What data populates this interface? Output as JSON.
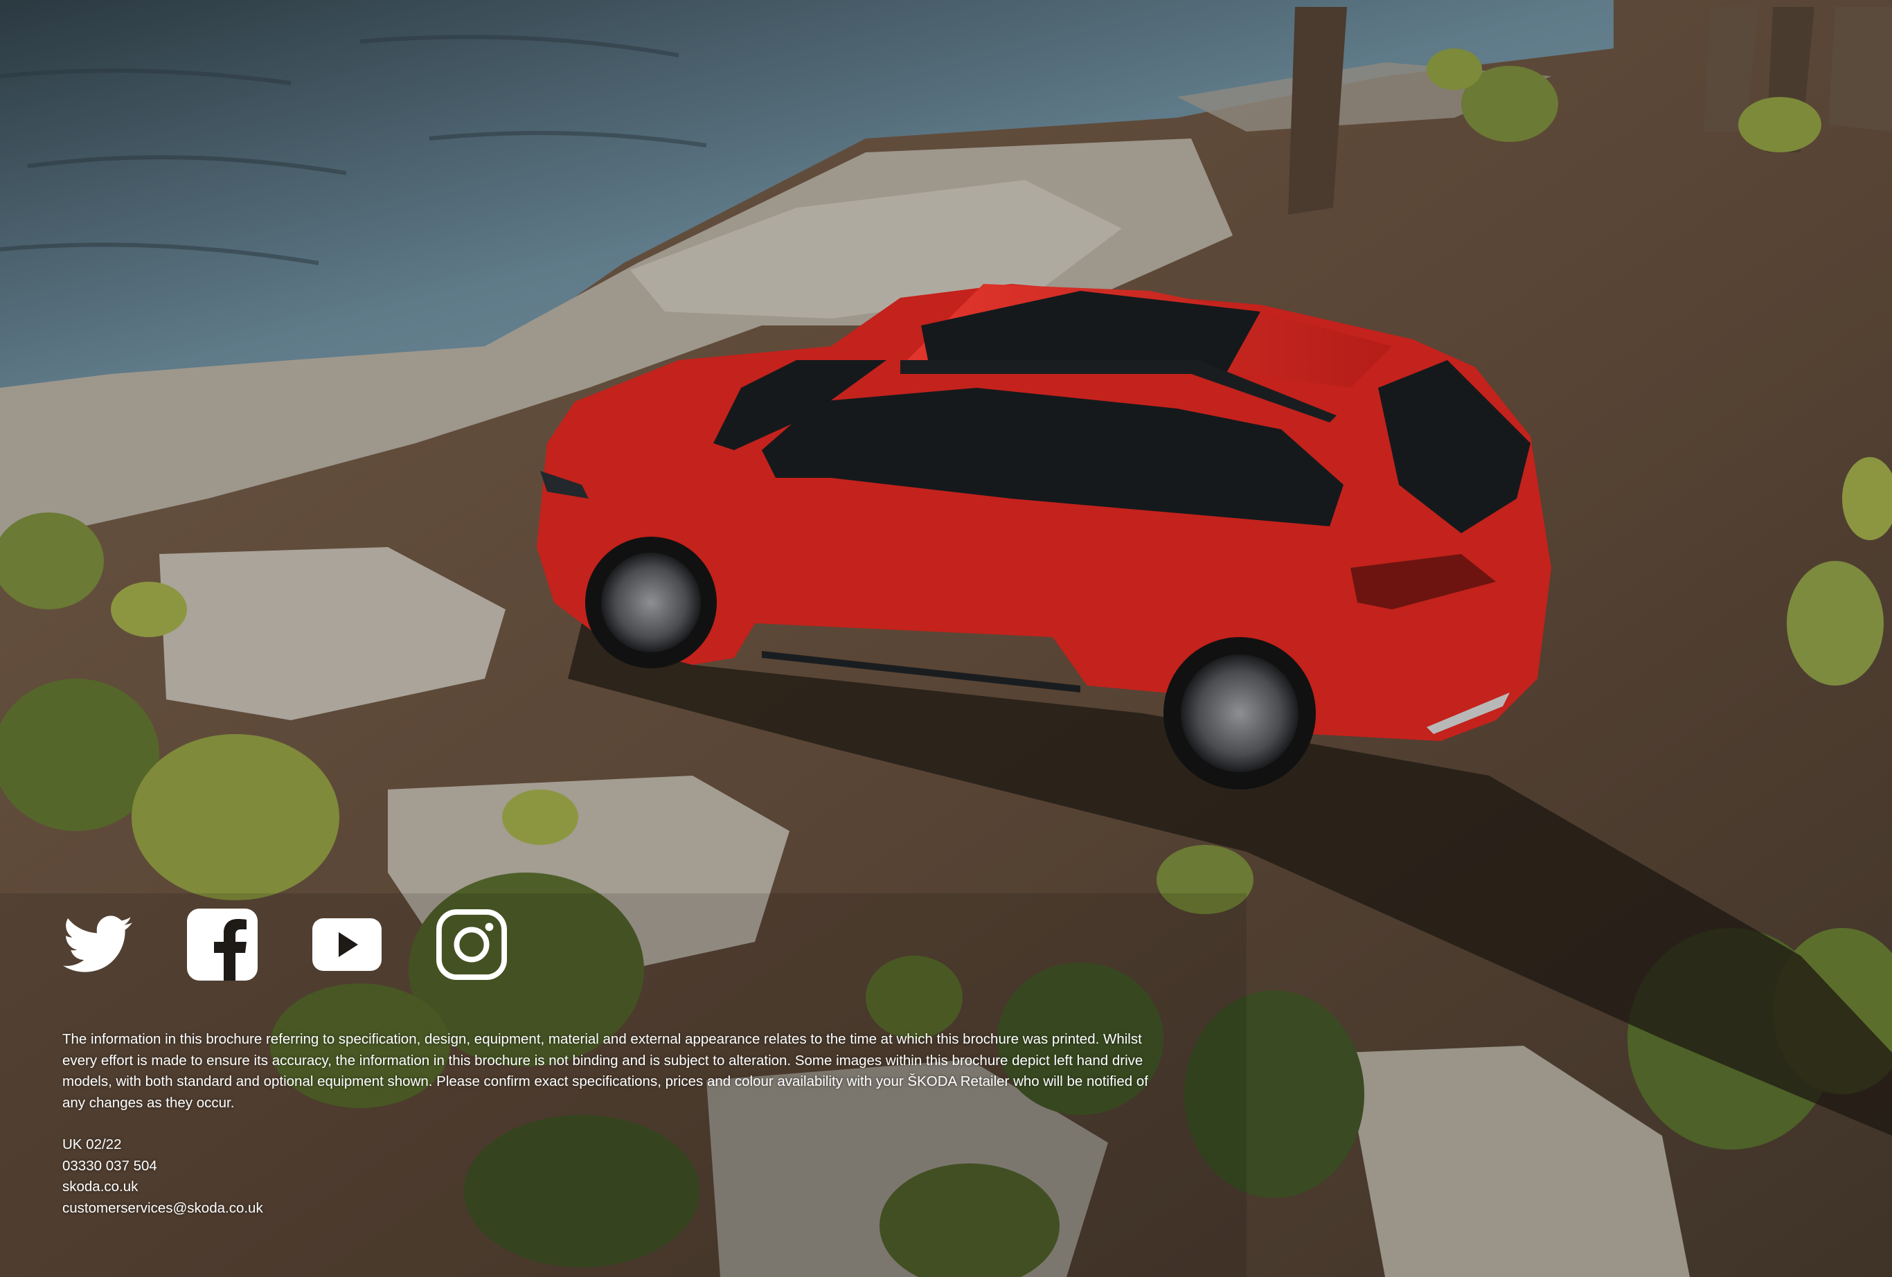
{
  "colors": {
    "water": "#5d7582",
    "ground": "#5a4636",
    "rock": "#9d978c",
    "car_body": "#c4221c",
    "car_dark": "#111416",
    "foliage": "#6b7a34",
    "text": "#ffffff"
  },
  "social": [
    {
      "name": "twitter",
      "icon": "twitter-bird-icon"
    },
    {
      "name": "facebook",
      "icon": "facebook-f-icon"
    },
    {
      "name": "youtube",
      "icon": "youtube-play-icon"
    },
    {
      "name": "instagram",
      "icon": "instagram-camera-icon"
    }
  ],
  "disclaimer": {
    "text": "The information in this brochure referring to specification, design, equipment, material and external appearance relates to the time at which this brochure was printed. Whilst every effort is made to ensure its accuracy, the information in this brochure is not binding and is subject to alteration. Some images within this brochure depict left hand drive models, with both standard and optional equipment shown. Please confirm exact specifications, prices and colour availability with your ŠKODA Retailer who will be notified of any changes as they occur."
  },
  "contact": {
    "edition": "UK 02/22",
    "phone": "03330 037 504",
    "website": "skoda.co.uk",
    "email": "customerservices@skoda.co.uk"
  }
}
